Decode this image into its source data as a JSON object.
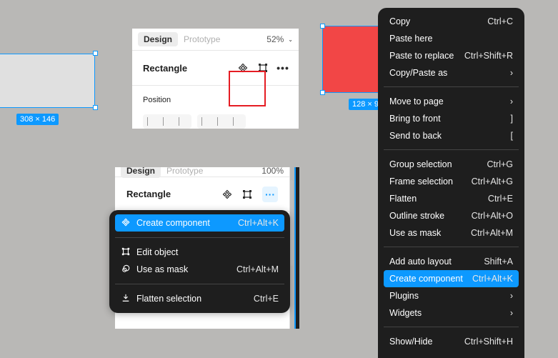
{
  "canvas": {
    "gray_rect_size": "308 × 146",
    "red_rect_size": "128 × 9"
  },
  "panel_top": {
    "tab_design": "Design",
    "tab_prototype": "Prototype",
    "zoom": "52%",
    "layer_name": "Rectangle",
    "section_title": "Position"
  },
  "panel_low": {
    "tab_design": "Design",
    "tab_prototype": "Prototype",
    "zoom": "100%",
    "layer_name": "Rectangle"
  },
  "menu_small": {
    "groups": [
      [
        {
          "label": "Create component",
          "shortcut": "Ctrl+Alt+K",
          "icon": "component-icon",
          "selected": true
        }
      ],
      [
        {
          "label": "Edit object",
          "shortcut": "",
          "icon": "edit-object-icon"
        },
        {
          "label": "Use as mask",
          "shortcut": "Ctrl+Alt+M",
          "icon": "mask-icon"
        }
      ],
      [
        {
          "label": "Flatten selection",
          "shortcut": "Ctrl+E",
          "icon": "flatten-icon"
        }
      ]
    ]
  },
  "menu_big": {
    "groups": [
      [
        {
          "label": "Copy",
          "shortcut": "Ctrl+C"
        },
        {
          "label": "Paste here",
          "shortcut": ""
        },
        {
          "label": "Paste to replace",
          "shortcut": "Ctrl+Shift+R"
        },
        {
          "label": "Copy/Paste as",
          "shortcut": "›"
        }
      ],
      [
        {
          "label": "Move to page",
          "shortcut": "›"
        },
        {
          "label": "Bring to front",
          "shortcut": "]"
        },
        {
          "label": "Send to back",
          "shortcut": "["
        }
      ],
      [
        {
          "label": "Group selection",
          "shortcut": "Ctrl+G"
        },
        {
          "label": "Frame selection",
          "shortcut": "Ctrl+Alt+G"
        },
        {
          "label": "Flatten",
          "shortcut": "Ctrl+E"
        },
        {
          "label": "Outline stroke",
          "shortcut": "Ctrl+Alt+O"
        },
        {
          "label": "Use as mask",
          "shortcut": "Ctrl+Alt+M"
        }
      ],
      [
        {
          "label": "Add auto layout",
          "shortcut": "Shift+A"
        },
        {
          "label": "Create component",
          "shortcut": "Ctrl+Alt+K",
          "selected": true
        },
        {
          "label": "Plugins",
          "shortcut": "›"
        },
        {
          "label": "Widgets",
          "shortcut": "›"
        }
      ],
      [
        {
          "label": "Show/Hide",
          "shortcut": "Ctrl+Shift+H"
        }
      ]
    ]
  },
  "colors": {
    "accent": "#0d99ff",
    "red_shape": "#f24646",
    "highlight": "#e51c23",
    "menu_bg": "#1e1e1e"
  }
}
